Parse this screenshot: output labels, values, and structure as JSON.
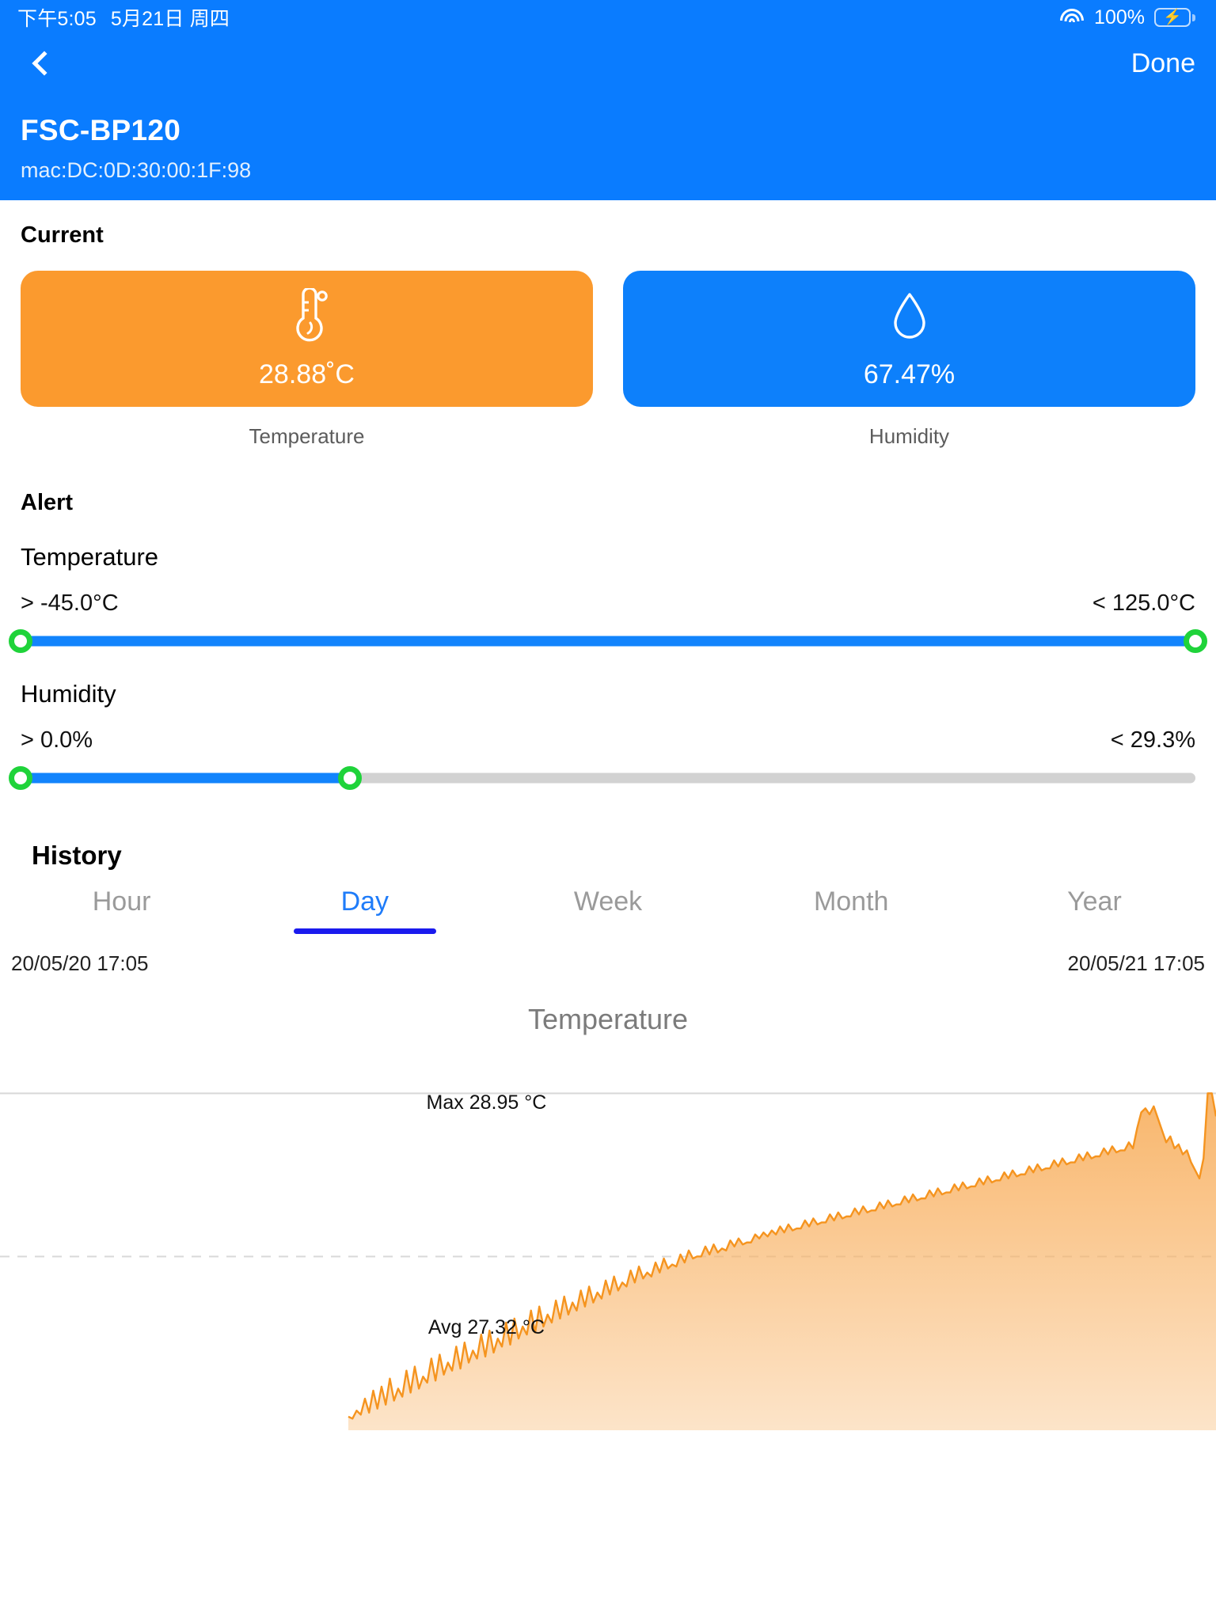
{
  "status_bar": {
    "time": "下午5:05",
    "date": "5月21日 周四",
    "battery_percent": "100%",
    "wifi_icon": "wifi-icon",
    "battery_icon": "battery-charging-icon"
  },
  "nav": {
    "back_icon": "chevron-left-icon",
    "done_label": "Done",
    "device_name": "FSC-BP120",
    "mac_label": "mac:DC:0D:30:00:1F:98"
  },
  "current": {
    "section_label": "Current",
    "temperature": {
      "value": "28.88˚C",
      "label": "Temperature",
      "icon": "thermometer-icon",
      "color": "#fb9a2e"
    },
    "humidity": {
      "value": "67.47%",
      "label": "Humidity",
      "icon": "water-drop-icon",
      "color": "#0d80fb"
    }
  },
  "alert": {
    "section_label": "Alert",
    "temperature": {
      "label": "Temperature",
      "min_label": "> -45.0°C",
      "max_label": "< 125.0°C",
      "min_percent": 0,
      "max_percent": 100
    },
    "humidity": {
      "label": "Humidity",
      "min_label": "> 0.0%",
      "max_label": "< 29.3%",
      "min_percent": 0,
      "max_percent": 28
    }
  },
  "history": {
    "section_label": "History",
    "tabs": [
      {
        "label": "Hour",
        "active": false
      },
      {
        "label": "Day",
        "active": true
      },
      {
        "label": "Week",
        "active": false
      },
      {
        "label": "Month",
        "active": false
      },
      {
        "label": "Year",
        "active": false
      }
    ],
    "start_time": "20/05/20 17:05",
    "end_time": "20/05/21 17:05"
  },
  "chart_data": {
    "type": "area",
    "title": "Temperature",
    "xlabel": "",
    "ylabel": "",
    "grid": true,
    "legend": "none",
    "max_label": "Max 28.95 °C",
    "avg_label": "Avg 27.32 °C",
    "max_value": 28.95,
    "avg_value": 27.32,
    "ylim": [
      25.6,
      29.0
    ],
    "series_color": "#f5941f",
    "fill_color": "#f8b264",
    "x_start": "20/05/20 17:05",
    "x_end": "20/05/21 17:05",
    "values": [
      25.72,
      25.7,
      25.78,
      25.74,
      25.9,
      25.76,
      25.98,
      25.8,
      26.02,
      25.84,
      26.1,
      25.88,
      26.0,
      25.92,
      26.18,
      25.96,
      26.22,
      26.0,
      26.12,
      26.06,
      26.3,
      26.08,
      26.34,
      26.14,
      26.26,
      26.18,
      26.42,
      26.2,
      26.46,
      26.26,
      26.38,
      26.3,
      26.54,
      26.32,
      26.58,
      26.36,
      26.5,
      26.42,
      26.66,
      26.44,
      26.7,
      26.5,
      26.62,
      26.54,
      26.78,
      26.56,
      26.82,
      26.62,
      26.74,
      26.66,
      26.88,
      26.7,
      26.92,
      26.74,
      26.86,
      26.78,
      26.98,
      26.82,
      27.02,
      26.86,
      26.96,
      26.9,
      27.08,
      26.94,
      27.12,
      26.98,
      27.06,
      27.02,
      27.18,
      27.06,
      27.22,
      27.1,
      27.16,
      27.12,
      27.26,
      27.16,
      27.3,
      27.2,
      27.24,
      27.22,
      27.34,
      27.26,
      27.38,
      27.3,
      27.32,
      27.32,
      27.42,
      27.34,
      27.44,
      27.36,
      27.4,
      27.38,
      27.48,
      27.42,
      27.5,
      27.44,
      27.46,
      27.46,
      27.54,
      27.5,
      27.56,
      27.52,
      27.58,
      27.54,
      27.62,
      27.56,
      27.64,
      27.58,
      27.6,
      27.6,
      27.68,
      27.62,
      27.7,
      27.64,
      27.66,
      27.66,
      27.74,
      27.68,
      27.76,
      27.7,
      27.72,
      27.72,
      27.8,
      27.74,
      27.82,
      27.76,
      27.78,
      27.78,
      27.86,
      27.8,
      27.88,
      27.82,
      27.84,
      27.84,
      27.92,
      27.86,
      27.94,
      27.88,
      27.9,
      27.9,
      27.98,
      27.92,
      28.0,
      27.94,
      27.96,
      27.96,
      28.04,
      27.98,
      28.06,
      28.0,
      28.02,
      28.02,
      28.1,
      28.04,
      28.12,
      28.06,
      28.08,
      28.08,
      28.16,
      28.1,
      28.18,
      28.12,
      28.14,
      28.14,
      28.22,
      28.16,
      28.24,
      28.18,
      28.2,
      28.2,
      28.28,
      28.22,
      28.3,
      28.24,
      28.26,
      28.26,
      28.34,
      28.28,
      28.36,
      28.3,
      28.32,
      28.32,
      28.4,
      28.34,
      28.42,
      28.36,
      28.38,
      28.38,
      28.46,
      28.4,
      28.6,
      28.76,
      28.8,
      28.74,
      28.82,
      28.7,
      28.58,
      28.46,
      28.52,
      28.4,
      28.44,
      28.34,
      28.38,
      28.26,
      28.18,
      28.1,
      28.3,
      28.95,
      28.95,
      28.72
    ]
  }
}
